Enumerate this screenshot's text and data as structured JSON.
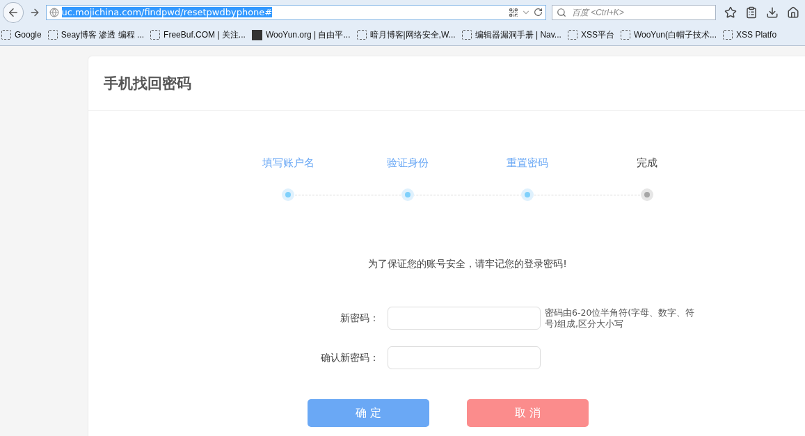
{
  "browser": {
    "url": "uc.mojichina.com/findpwd/resetpwdbyphone#",
    "search": {
      "placeholder": "百度 <Ctrl+K>"
    },
    "bookmarks": [
      {
        "label": "Google",
        "kind": "blank"
      },
      {
        "label": "Seay博客 渗透 编程 ...",
        "kind": "blank"
      },
      {
        "label": "FreeBuf.COM | 关注...",
        "kind": "blank"
      },
      {
        "label": "WooYun.org | 自由平...",
        "kind": "site"
      },
      {
        "label": "暗月博客|网络安全,W...",
        "kind": "blank"
      },
      {
        "label": "编辑器漏洞手册 | Nav...",
        "kind": "blank"
      },
      {
        "label": "XSS平台",
        "kind": "blank"
      },
      {
        "label": "WooYun(白帽子技术...",
        "kind": "blank"
      },
      {
        "label": "XSS Platfo",
        "kind": "blank"
      }
    ]
  },
  "page": {
    "title": "手机找回密码",
    "steps": [
      {
        "label": "填写账户名",
        "done": true
      },
      {
        "label": "验证身份",
        "done": true
      },
      {
        "label": "重置密码",
        "done": true
      },
      {
        "label": "完成",
        "done": false
      }
    ],
    "notice": "为了保证您的账号安全，请牢记您的登录密码!",
    "fields": [
      {
        "label": "新密码：",
        "hint": "密码由6-20位半角符(字母、数字、符号)组成,区分大小写"
      },
      {
        "label": "确认新密码："
      }
    ],
    "buttons": [
      {
        "label": "确 定",
        "kind": "primary"
      },
      {
        "label": "取 消",
        "kind": "cancel"
      }
    ]
  }
}
